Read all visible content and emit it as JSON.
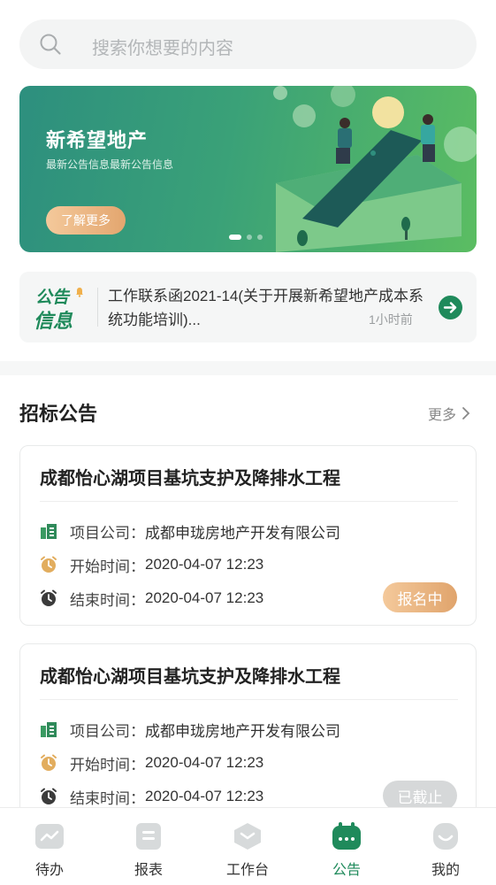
{
  "search": {
    "placeholder": "搜索你想要的内容"
  },
  "banner": {
    "title": "新希望地产",
    "subtitle": "最新公告信息最新公告信息",
    "button": "了解更多"
  },
  "notice": {
    "logo_line1": "公告",
    "logo_line2": "信息",
    "text": "工作联系函2021-14(关于开展新希望地产成本系统功能培训)...",
    "time": "1小时前"
  },
  "section": {
    "title": "招标公告",
    "more": "更多"
  },
  "cards": [
    {
      "title": "成都怡心湖项目基坑支护及降排水工程",
      "company_label": "项目公司：",
      "company": "成都申珑房地产开发有限公司",
      "start_label": "开始时间：",
      "start": "2020-04-07  12:23",
      "end_label": "结束时间：",
      "end": "2020-04-07  12:23",
      "status": "报名中"
    },
    {
      "title": "成都怡心湖项目基坑支护及降排水工程",
      "company_label": "项目公司：",
      "company": "成都申珑房地产开发有限公司",
      "start_label": "开始时间：",
      "start": "2020-04-07  12:23",
      "end_label": "结束时间：",
      "end": "2020-04-07  12:23",
      "status": "已截止"
    }
  ],
  "tabs": [
    {
      "label": "待办",
      "icon": "todo-icon"
    },
    {
      "label": "报表",
      "icon": "report-icon"
    },
    {
      "label": "工作台",
      "icon": "workbench-icon"
    },
    {
      "label": "公告",
      "icon": "announcement-icon",
      "active": true
    },
    {
      "label": "我的",
      "icon": "profile-icon"
    }
  ],
  "colors": {
    "brand_green": "#1f8a5b",
    "badge_orange": "#e0a46c",
    "badge_gray": "#d6d8d9"
  }
}
